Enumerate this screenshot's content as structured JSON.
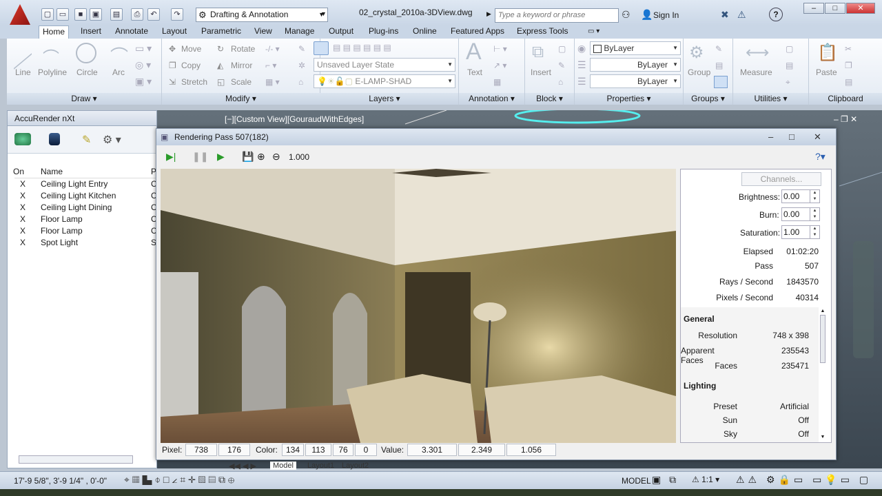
{
  "titlebar": {
    "workspace": "Drafting & Annotation",
    "document_title": "02_crystal_2010a-3DView.dwg",
    "search_placeholder": "Type a keyword or phrase",
    "sign_in": "Sign In",
    "help": "?"
  },
  "ribbon": {
    "tabs": [
      "Home",
      "Insert",
      "Annotate",
      "Layout",
      "Parametric",
      "View",
      "Manage",
      "Output",
      "Plug-ins",
      "Online",
      "Featured Apps",
      "Express Tools"
    ],
    "active_tab": "Home",
    "draw": {
      "line": "Line",
      "polyline": "Polyline",
      "circle": "Circle",
      "arc": "Arc",
      "label": "Draw"
    },
    "modify": {
      "move": "Move",
      "rotate": "Rotate",
      "copy": "Copy",
      "mirror": "Mirror",
      "stretch": "Stretch",
      "scale": "Scale",
      "label": "Modify"
    },
    "layers": {
      "layer_state": "Unsaved Layer State",
      "current_layer": "E-LAMP-SHAD",
      "label": "Layers"
    },
    "annotation": {
      "text": "Text",
      "label": "Annotation"
    },
    "block": {
      "insert": "Insert",
      "label": "Block"
    },
    "properties": {
      "color": "ByLayer",
      "linetype": "ByLayer",
      "lineweight": "ByLayer",
      "label": "Properties"
    },
    "groups": {
      "group": "Group",
      "label": "Groups"
    },
    "utilities": {
      "measure": "Measure",
      "label": "Utilities"
    },
    "clipboard": {
      "paste": "Paste",
      "label": "Clipboard"
    }
  },
  "palette": {
    "title": "AccuRender nXt",
    "columns": {
      "on": "On",
      "name": "Name",
      "extra": "P"
    },
    "lights": [
      {
        "on": "X",
        "name": "Ceiling Light Entry",
        "extra": "C"
      },
      {
        "on": "X",
        "name": "Ceiling Light Kitchen",
        "extra": "C"
      },
      {
        "on": "X",
        "name": "Ceiling Light Dining",
        "extra": "C"
      },
      {
        "on": "X",
        "name": "Floor Lamp",
        "extra": "C"
      },
      {
        "on": "X",
        "name": "Floor Lamp",
        "extra": "C"
      },
      {
        "on": "X",
        "name": "Spot Light",
        "extra": "S"
      }
    ]
  },
  "viewport": {
    "label": "[−][Custom View][GouraudWithEdges]"
  },
  "render_window": {
    "title": "Rendering Pass 507(182)",
    "zoom": "1.000",
    "channels_button": "Channels...",
    "brightness": {
      "label": "Brightness:",
      "value": "0.00"
    },
    "burn": {
      "label": "Burn:",
      "value": "0.00"
    },
    "saturation": {
      "label": "Saturation:",
      "value": "1.00"
    },
    "stats": [
      {
        "label": "Elapsed",
        "value": "01:02:20"
      },
      {
        "label": "Pass",
        "value": "507"
      },
      {
        "label": "Rays / Second",
        "value": "1843570"
      },
      {
        "label": "Pixels / Second",
        "value": "40314"
      }
    ],
    "general": {
      "heading": "General",
      "rows": [
        {
          "label": "Resolution",
          "value": "748 x 398"
        },
        {
          "label": "Apparent Faces",
          "value": "235543"
        },
        {
          "label": "Faces",
          "value": "235471"
        }
      ]
    },
    "lighting": {
      "heading": "Lighting",
      "rows": [
        {
          "label": "Preset",
          "value": "Artificial"
        },
        {
          "label": "Sun",
          "value": "Off"
        },
        {
          "label": "Sky",
          "value": "Off"
        }
      ]
    },
    "status": {
      "pixel_label": "Pixel:",
      "px": "738",
      "py": "176",
      "color_label": "Color:",
      "r": "134",
      "g": "113",
      "b": "76",
      "a": "0",
      "value_label": "Value:",
      "v1": "3.301",
      "v2": "2.349",
      "v3": "1.056"
    }
  },
  "layout_tabs": [
    "Model",
    "Layout1",
    "Layout2"
  ],
  "statusbar": {
    "coords": "17'-9 5/8\",  3'-9 1/4\" , 0'-0\"",
    "model": "MODEL",
    "scale": "1:1"
  }
}
